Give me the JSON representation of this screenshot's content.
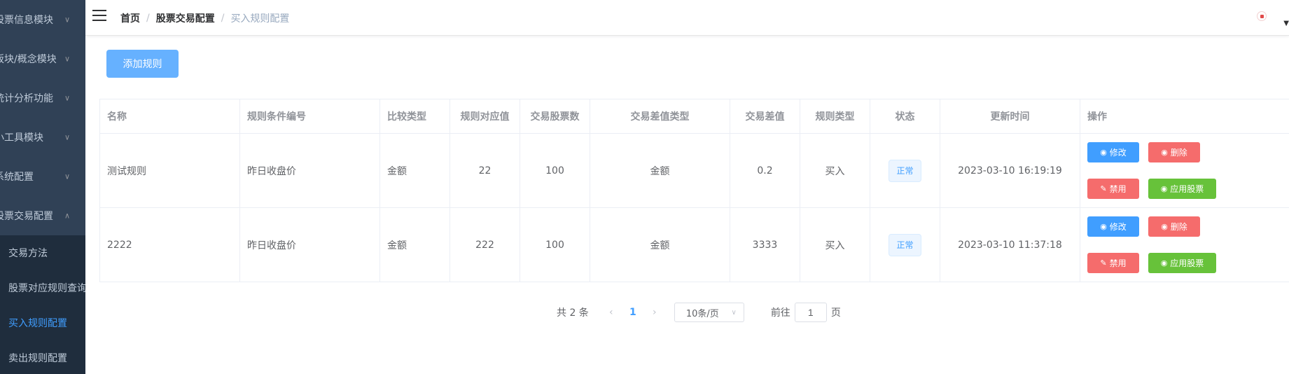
{
  "sidebar": {
    "menus": [
      {
        "label": "股票信息模块",
        "expanded": false
      },
      {
        "label": "板块/概念模块",
        "expanded": false
      },
      {
        "label": "统计分析功能",
        "expanded": false
      },
      {
        "label": "小工具模块",
        "expanded": false
      },
      {
        "label": "系统配置",
        "expanded": false
      },
      {
        "label": "股票交易配置",
        "expanded": true
      }
    ],
    "submenu": [
      {
        "label": "交易方法",
        "active": false
      },
      {
        "label": "股票对应规则查询",
        "active": false
      },
      {
        "label": "买入规则配置",
        "active": true
      },
      {
        "label": "卖出规则配置",
        "active": false
      }
    ]
  },
  "breadcrumb": [
    "首页",
    "股票交易配置",
    "买入规则配置"
  ],
  "toolbar": {
    "add_label": "添加规则"
  },
  "table": {
    "columns": [
      "名称",
      "规则条件编号",
      "比较类型",
      "规则对应值",
      "交易股票数",
      "交易差值类型",
      "交易差值",
      "规则类型",
      "状态",
      "更新时间",
      "操作"
    ],
    "rows": [
      {
        "name": "测试规则",
        "condition": "昨日收盘价",
        "compare_type": "金额",
        "rule_value": "22",
        "shares": "100",
        "diff_type": "金额",
        "diff_value": "0.2",
        "rule_type": "买入",
        "status": "正常",
        "updated": "2023-03-10 16:19:19"
      },
      {
        "name": "2222",
        "condition": "昨日收盘价",
        "compare_type": "金额",
        "rule_value": "222",
        "shares": "100",
        "diff_type": "金额",
        "diff_value": "3333",
        "rule_type": "买入",
        "status": "正常",
        "updated": "2023-03-10 11:37:18"
      }
    ],
    "actions": {
      "edit": "修改",
      "delete": "删除",
      "disable": "禁用",
      "apply": "应用股票"
    }
  },
  "pagination": {
    "total_text": "共 2 条",
    "current_page": "1",
    "page_size": "10条/页",
    "goto_label": "前往",
    "goto_value": "1",
    "page_suffix": "页"
  },
  "colors": {
    "sidebar_bg": "#304156",
    "submenu_bg": "#1f2d3d",
    "primary": "#409eff",
    "danger": "#f56c6c",
    "success": "#67c23a"
  },
  "icons": {
    "menu": "hamburger-icon",
    "arrow": "chevron-icon",
    "edit": "edit-icon",
    "delete": "delete-icon",
    "disable": "pencil-icon",
    "apply": "apply-icon"
  }
}
